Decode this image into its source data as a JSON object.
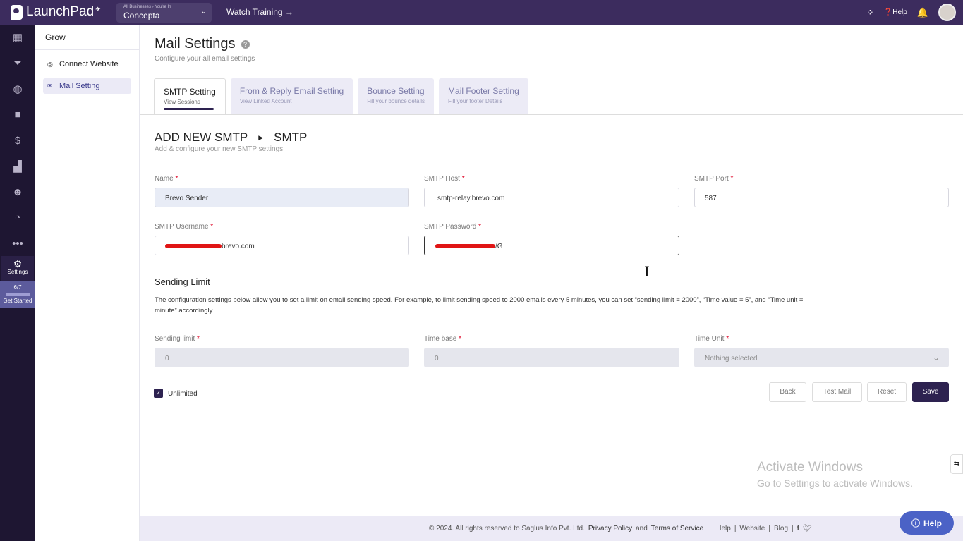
{
  "topbar": {
    "logo": "LaunchPad",
    "business_context": "All Businesses › You're In",
    "business_name": "Concepta",
    "watch_training": "Watch Training →",
    "help": "Help"
  },
  "rail": {
    "settings_label": "Settings",
    "progress": "6/7",
    "progress_fraction": 0.857,
    "get_started": "Get Started"
  },
  "subnav": {
    "heading": "Grow",
    "items": [
      {
        "label": "Connect Website",
        "icon": "globe-icon"
      },
      {
        "label": "Mail Setting",
        "icon": "mail-icon"
      }
    ]
  },
  "page": {
    "title": "Mail Settings",
    "subtitle": "Configure your all email settings"
  },
  "tabs": [
    {
      "label": "SMTP Setting",
      "sub": "View Sessions"
    },
    {
      "label": "From & Reply Email Setting",
      "sub": "View Linked Account"
    },
    {
      "label": "Bounce Setting",
      "sub": "Fill your bounce details"
    },
    {
      "label": "Mail Footer Setting",
      "sub": "Fill your footer Details"
    }
  ],
  "section": {
    "title_left": "ADD NEW SMTP",
    "title_right": "SMTP",
    "subtitle": "Add & configure your new SMTP settings"
  },
  "form": {
    "name_label": "Name",
    "name_value": "Brevo Sender",
    "host_label": "SMTP Host",
    "host_value": "smtp-relay.brevo.com",
    "port_label": "SMTP Port",
    "port_value": "587",
    "username_label": "SMTP Username",
    "username_suffix": "brevo.com",
    "password_label": "SMTP Password",
    "password_tail": "/G",
    "required_mark": "*"
  },
  "sending": {
    "title": "Sending Limit",
    "description": "The configuration settings below allow you to set a limit on email sending speed. For example, to limit sending speed to 2000 emails every 5 minutes, you can set “sending limit = 2000”, “Time value = 5”, and “Time unit = minute” accordingly.",
    "limit_label": "Sending limit",
    "limit_value": "0",
    "timebase_label": "Time base",
    "timebase_value": "0",
    "timeunit_label": "Time Unit",
    "timeunit_value": "Nothing selected",
    "unlimited_label": "Unlimited"
  },
  "buttons": {
    "back": "Back",
    "test": "Test Mail",
    "reset": "Reset",
    "save": "Save"
  },
  "footer": {
    "copyright": "© 2024. All rights reserved to Saglus Info Pvt. Ltd.",
    "privacy": "Privacy Policy",
    "and": "and",
    "terms": "Terms of Service",
    "help": "Help",
    "website": "Website",
    "blog": "Blog",
    "sep": "|"
  },
  "watermark": {
    "line1": "Activate Windows",
    "line2": "Go to Settings to activate Windows."
  },
  "help_button": "Help",
  "colors": {
    "topbar": "#3c2c5e",
    "rail": "#1e1632",
    "accent": "#2d2250",
    "help": "#4b62c6"
  }
}
